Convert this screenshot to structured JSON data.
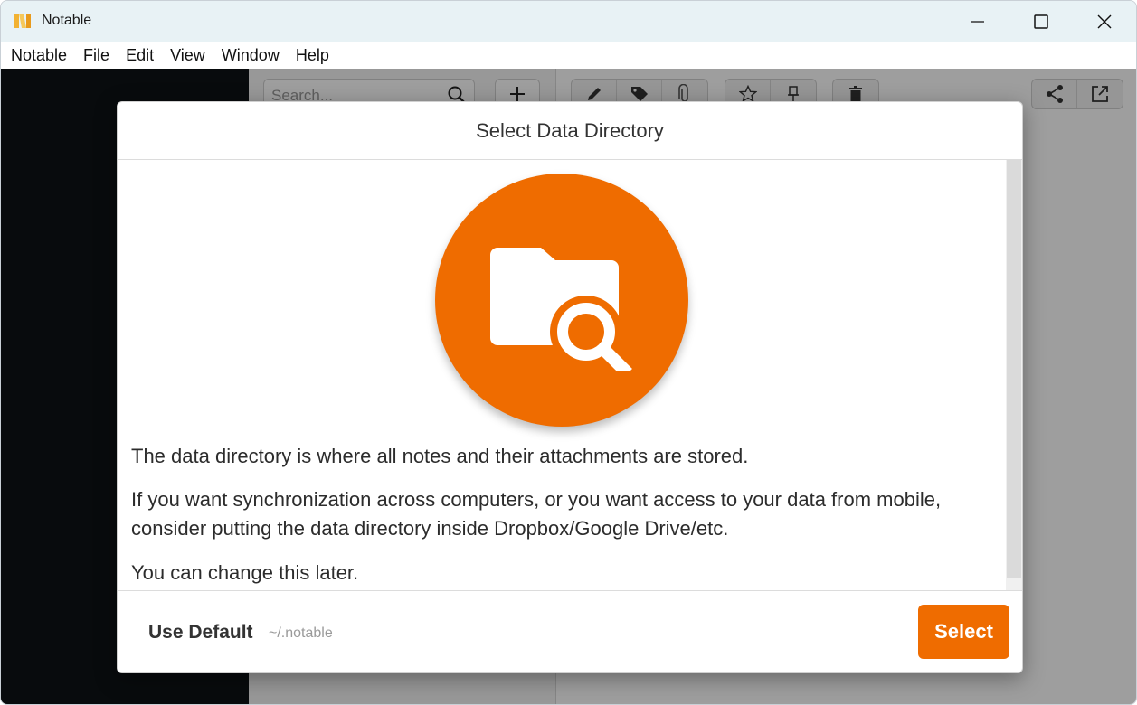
{
  "window": {
    "title": "Notable"
  },
  "menu": [
    "Notable",
    "File",
    "Edit",
    "View",
    "Window",
    "Help"
  ],
  "toolbar": {
    "search_placeholder": "Search..."
  },
  "dialog": {
    "title": "Select Data Directory",
    "paragraphs": [
      "The data directory is where all notes and their attachments are stored.",
      "If you want synchronization across computers, or you want access to your data from mobile, consider putting the data directory inside Dropbox/Google Drive/etc.",
      "You can change this later."
    ],
    "use_default_label": "Use Default",
    "default_path": "~/.notable",
    "select_label": "Select"
  },
  "colors": {
    "accent": "#ef6c00",
    "sidebar": "#0e1215",
    "titlebar": "#e8f2f5"
  },
  "icons": [
    "notable-logo-icon",
    "minimize-icon",
    "maximize-icon",
    "close-icon",
    "search-icon",
    "plus-icon",
    "pencil-icon",
    "tag-icon",
    "paperclip-icon",
    "star-icon",
    "pin-icon",
    "trash-icon",
    "share-icon",
    "open-external-icon",
    "folder-search-icon"
  ]
}
